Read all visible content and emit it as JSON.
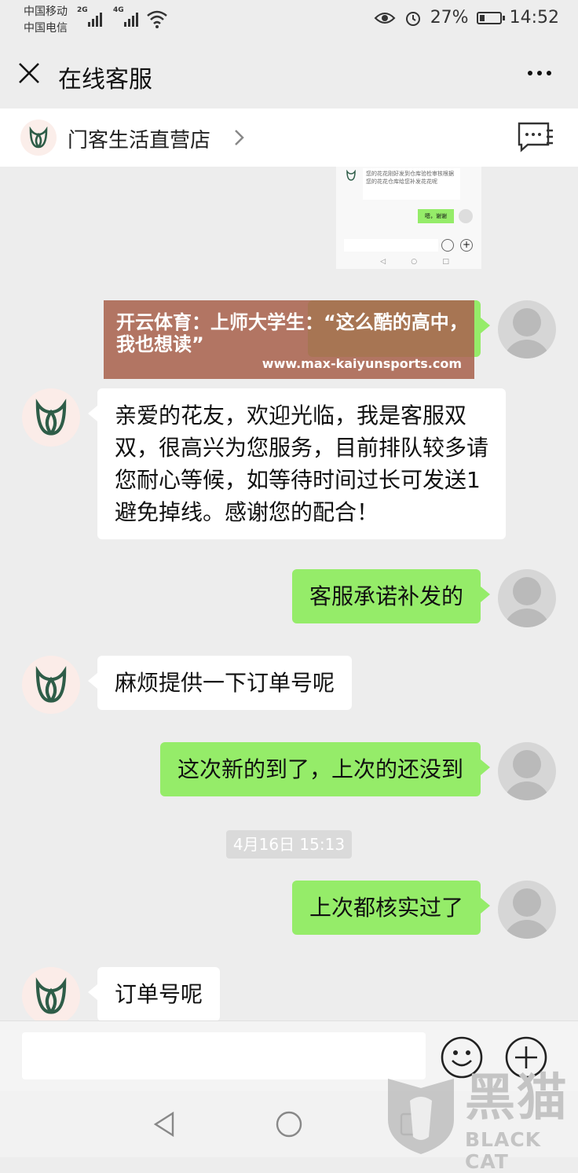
{
  "status_bar": {
    "carrier_1": "中国移动",
    "carrier_2": "中国电信",
    "net_1": "2G",
    "net_2": "4G",
    "battery": "27%",
    "battery_level": 0.27,
    "time": "14:52"
  },
  "header": {
    "title": "在线客服",
    "close_icon": "close-icon",
    "more_icon": "more-icon"
  },
  "shop": {
    "name": "门客生活直营店",
    "chevron_icon": "chevron-right-icon",
    "service_icon": "chat-list-icon"
  },
  "preview": {
    "agent_text": "您的花花刚好发到仓库验检审核根据您的花花仓库给您补发花花呢",
    "user_text": "嗯，谢谢",
    "nav": [
      "◁",
      "○",
      "□"
    ]
  },
  "overlay": {
    "title": "开云体育：上师大学生：“这么酷的高中，我也想读”",
    "url": "www.max-kaiyunsports.com"
  },
  "messages": [
    {
      "from": "agent",
      "text": "亲爱的花友，欢迎光临，我是客服双双，很高兴为您服务，目前排队较多请您耐心等候，如等待时间过长可发送1避免掉线。感谢您的配合！"
    },
    {
      "from": "user",
      "text": "客服承诺补发的"
    },
    {
      "from": "agent",
      "text": "麻烦提供一下订单号呢"
    },
    {
      "from": "user",
      "text": "这次新的到了，上次的还没到"
    },
    {
      "from": "user",
      "text": "上次都核实过了"
    },
    {
      "from": "agent",
      "text": "订单号呢"
    }
  ],
  "timestamp": "4月16日 15:13",
  "input": {
    "placeholder": "",
    "emoji_icon": "emoji-icon",
    "plus_icon": "plus-icon"
  },
  "nav": {
    "back_icon": "back-triangle-icon",
    "home_icon": "home-circle-icon",
    "recent_icon": "recent-square-icon"
  },
  "watermark": {
    "brand_cn": "黑猫",
    "brand_en": "BLACK CAT"
  },
  "colors": {
    "background": "#ededed",
    "user_bubble": "#95ec69",
    "agent_bubble": "#ffffff",
    "brand_green": "#2e5d48"
  }
}
